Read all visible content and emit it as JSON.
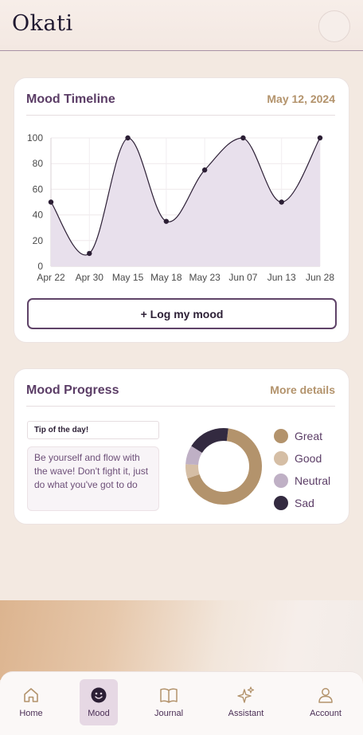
{
  "app": {
    "logo": "Okati"
  },
  "timeline": {
    "title": "Mood Timeline",
    "date": "May 12, 2024",
    "button_label": "+ Log my mood"
  },
  "progress": {
    "title": "Mood Progress",
    "link": "More details",
    "tip_label": "Tip of the day!",
    "tip_text": "Be yourself and flow with the wave! Don't fight it, just do what you've got to do",
    "legend": [
      {
        "label": "Great",
        "color": "#b3936c"
      },
      {
        "label": "Good",
        "color": "#d5bea5"
      },
      {
        "label": "Neutral",
        "color": "#bfb0c5"
      },
      {
        "label": "Sad",
        "color": "#332a40"
      }
    ]
  },
  "chart_data": [
    {
      "type": "area",
      "title": "",
      "xlabel": "",
      "ylabel": "",
      "categories": [
        "Apr 22",
        "Apr 30",
        "May 15",
        "May 18",
        "May 23",
        "Jun 07",
        "Jun 13",
        "Jun 28"
      ],
      "series": [
        {
          "values": [
            50,
            10,
            100,
            35,
            75,
            100,
            50,
            100
          ]
        }
      ],
      "ylim": [
        0,
        100
      ],
      "yticks": [
        0,
        20,
        40,
        60,
        80,
        100
      ],
      "grid": true,
      "line_color": "#2c1f35",
      "fill_color": "#e8e0ec"
    },
    {
      "type": "pie",
      "labels": [
        "Great",
        "Good",
        "Neutral",
        "Sad"
      ],
      "values": [
        68,
        6,
        8,
        18
      ],
      "colors": [
        "#b3936c",
        "#d5bea5",
        "#bfb0c5",
        "#332a40"
      ]
    }
  ],
  "nav": {
    "items": [
      {
        "label": "Home",
        "icon": "home-icon",
        "active": false
      },
      {
        "label": "Mood",
        "icon": "smile-icon",
        "active": true
      },
      {
        "label": "Journal",
        "icon": "book-icon",
        "active": false
      },
      {
        "label": "Assistant",
        "icon": "sparkle-icon",
        "active": false
      },
      {
        "label": "Account",
        "icon": "user-icon",
        "active": false
      }
    ]
  }
}
